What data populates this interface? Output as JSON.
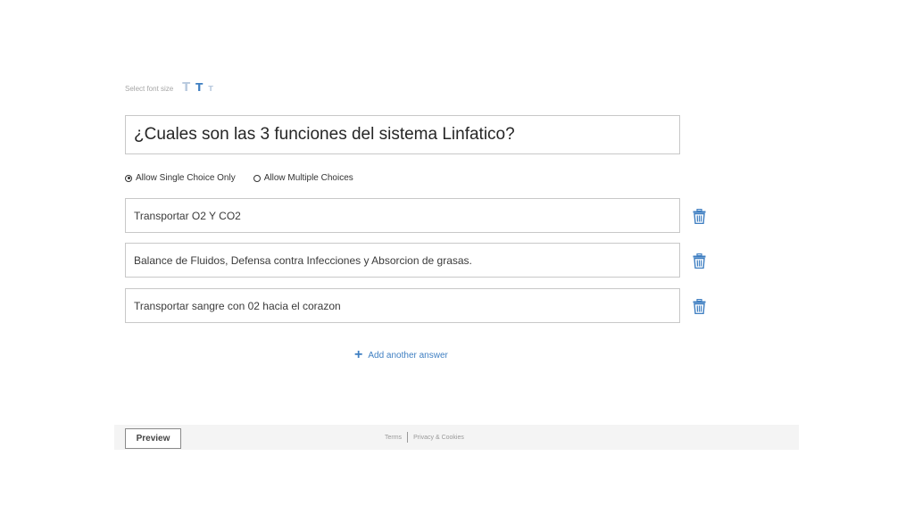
{
  "font_size": {
    "label": "Select font size",
    "large": "T",
    "medium": "T",
    "small": "T"
  },
  "question": {
    "text": "¿Cuales son las 3 funciones del sistema Linfatico?"
  },
  "choice_mode": {
    "single_label": "Allow Single Choice Only",
    "multiple_label": "Allow Multiple Choices",
    "selected": "single"
  },
  "answers": [
    {
      "text": "Transportar O2 Y CO2",
      "icon": "trash-icon"
    },
    {
      "text": "Balance de Fluidos, Defensa contra Infecciones y Absorcion de grasas.",
      "icon": "trash-icon"
    },
    {
      "text": "Transportar sangre con 02 hacia el corazon",
      "icon": "trash-icon"
    }
  ],
  "add_answer": {
    "icon": "plus-icon",
    "label": "Add another answer"
  },
  "footer": {
    "preview_label": "Preview",
    "terms_label": "Terms",
    "privacy_label": "Privacy & Cookies"
  },
  "colors": {
    "accent": "#3f7fc2",
    "border": "#c8c8c8",
    "footer_bg": "#f4f4f4"
  }
}
